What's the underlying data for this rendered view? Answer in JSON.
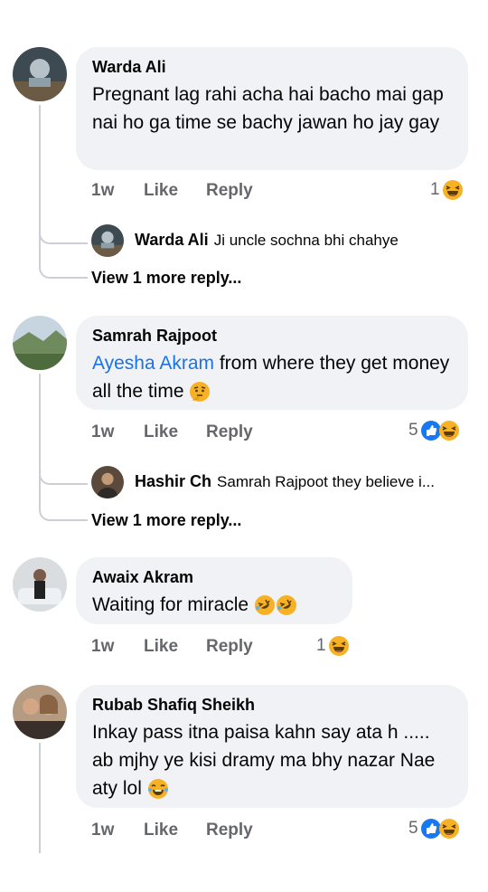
{
  "comments": [
    {
      "author": "Warda Ali",
      "text": "Pregnant lag rahi acha hai bacho mai gap nai ho ga time se bachy jawan ho jay gay",
      "time": "1w",
      "like": "Like",
      "reply": "Reply",
      "reaction_count": "1",
      "reactions": [
        "haha-emoji"
      ],
      "reply_preview": {
        "author": "Warda Ali",
        "text": "Ji uncle sochna bhi chahye"
      },
      "view_more": "View 1 more reply..."
    },
    {
      "author": "Samrah Rajpoot",
      "mention": "Ayesha Akram",
      "text": " from where they get money all the time",
      "time": "1w",
      "like": "Like",
      "reply": "Reply",
      "reaction_count": "5",
      "reactions": [
        "like-emoji",
        "haha-emoji"
      ],
      "reply_preview": {
        "author": "Hashir Ch",
        "text": "Samrah Rajpoot they believe i..."
      },
      "view_more": "View 1 more reply..."
    },
    {
      "author": "Awaix Akram",
      "text": "Waiting for miracle",
      "time": "1w",
      "like": "Like",
      "reply": "Reply",
      "reaction_count": "1",
      "reactions": [
        "haha-emoji"
      ]
    },
    {
      "author": "Rubab Shafiq Sheikh",
      "text": "Inkay pass itna paisa kahn say ata h ..... ab mjhy ye kisi dramy ma bhy nazar Nae aty lol",
      "time": "1w",
      "like": "Like",
      "reply": "Reply",
      "reaction_count": "5",
      "reactions": [
        "like-emoji",
        "haha-emoji"
      ]
    }
  ],
  "colors": {
    "bubble": "#f0f2f5",
    "link": "#1b74e4",
    "meta": "#65676b",
    "like": "#1877f2",
    "haha": "#f7b125"
  }
}
